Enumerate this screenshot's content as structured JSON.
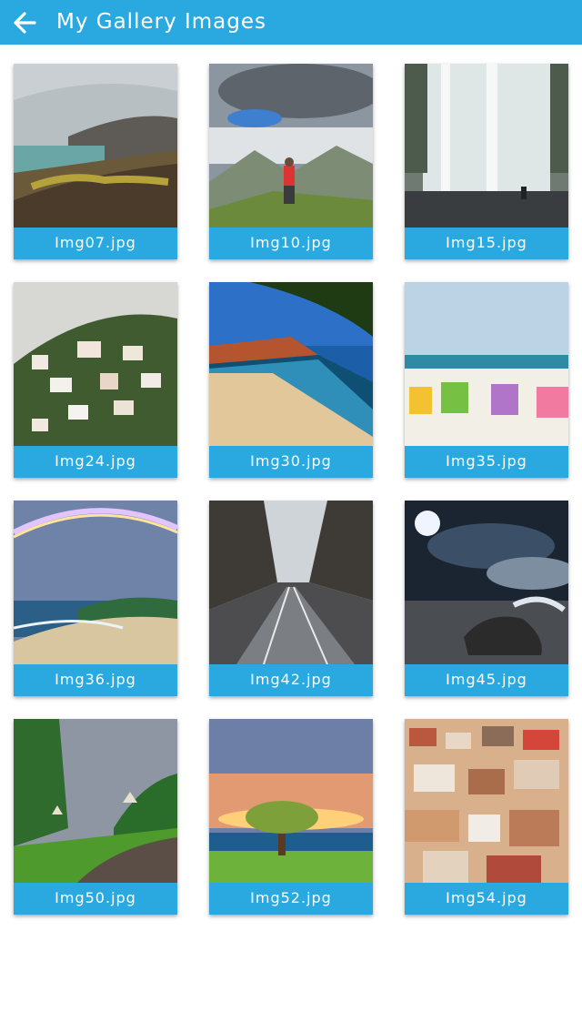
{
  "app": {
    "title": "My Gallery Images",
    "back_icon": "arrow-left-icon",
    "accent": "#29a9e0"
  },
  "gallery": {
    "items": [
      {
        "label": "Img07.jpg"
      },
      {
        "label": "Img10.jpg"
      },
      {
        "label": "Img15.jpg"
      },
      {
        "label": "Img24.jpg"
      },
      {
        "label": "Img30.jpg"
      },
      {
        "label": "Img35.jpg"
      },
      {
        "label": "Img36.jpg"
      },
      {
        "label": "Img42.jpg"
      },
      {
        "label": "Img45.jpg"
      },
      {
        "label": "Img50.jpg"
      },
      {
        "label": "Img52.jpg"
      },
      {
        "label": "Img54.jpg"
      }
    ]
  }
}
